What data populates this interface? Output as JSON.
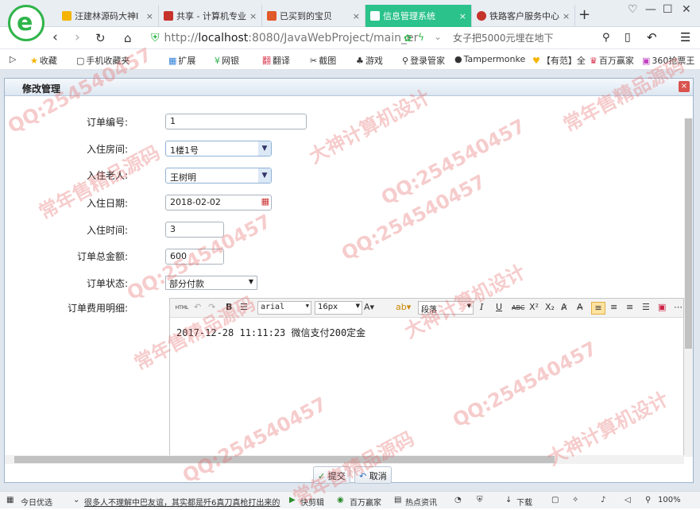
{
  "tabs": [
    {
      "label": "汪建林源码大神I",
      "fav_color": "#f5b400"
    },
    {
      "label": "共享 - 计算机专业",
      "fav_color": "#c6332b"
    },
    {
      "label": "已买到的宝贝",
      "fav_color": "#e05a2a"
    },
    {
      "label": "信息管理系统",
      "fav_color": "#ffffff",
      "active": true
    },
    {
      "label": "铁路客户服务中心",
      "fav_color": "#c6332b"
    }
  ],
  "tab_close_glyph": "×",
  "new_tab_glyph": "+",
  "address": {
    "protocol": "http://",
    "host": "localhost",
    "rest": ":8080/JavaWebProject/main_er"
  },
  "search_placeholder": "女子把5000元埋在地下",
  "bookmarks": [
    "收藏",
    "手机收藏夹",
    "扩展",
    "网银",
    "翻译",
    "截图",
    "游戏",
    "登录管家",
    "Tampermonke",
    "【有范】全",
    "百万赢家",
    "360抢票王"
  ],
  "panel": {
    "title": "修改管理"
  },
  "form": {
    "order_no": {
      "label": "订单编号:",
      "value": "1"
    },
    "room": {
      "label": "入住房间:",
      "value": "1楼1号"
    },
    "elder": {
      "label": "入住老人:",
      "value": "王树明"
    },
    "date": {
      "label": "入住日期:",
      "value": "2018-02-02"
    },
    "duration": {
      "label": "入住时间:",
      "value": "3"
    },
    "total": {
      "label": "订单总金额:",
      "value": "600"
    },
    "status": {
      "label": "订单状态:",
      "value": "部分付款"
    },
    "detail": {
      "label": "订单费用明细:"
    }
  },
  "editor": {
    "font": "arial",
    "size": "16px",
    "paragraph": "段落",
    "content": "2017-12-28 11:11:23  微信支付200定金",
    "html_btn": "HTML"
  },
  "buttons": {
    "submit": "提交",
    "cancel": "取消"
  },
  "statusbar": {
    "left": "今日优选",
    "news": "很多人不理解中巴友谊，其实都是歼6真刀真枪打出来的",
    "items": [
      "快剪辑",
      "百万赢家",
      "热点资讯",
      "下载"
    ],
    "zoom": "100%"
  },
  "watermarks": [
    "QQ:254540457",
    "常年售精品源码",
    "大神计算机设计"
  ]
}
